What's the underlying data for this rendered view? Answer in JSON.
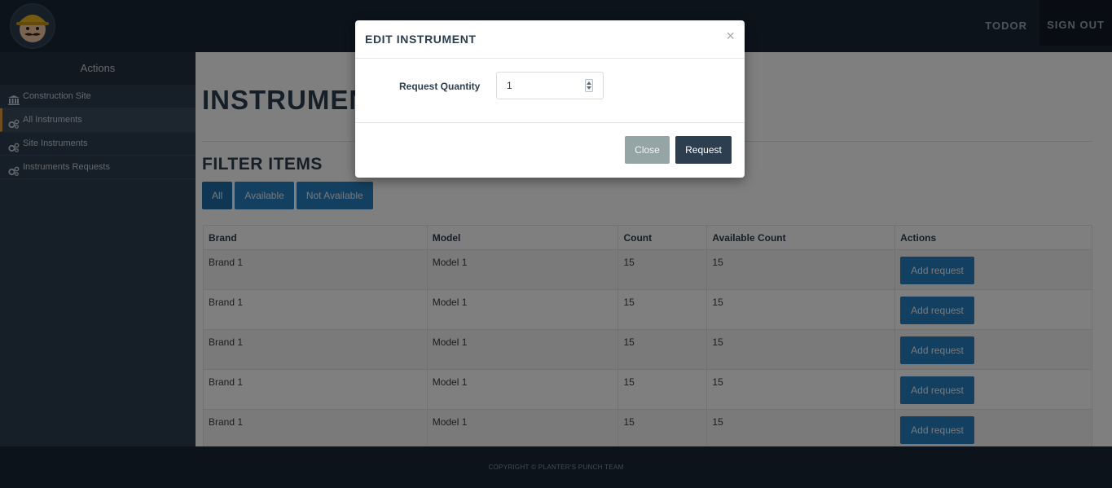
{
  "navbar": {
    "user_label": "TODOR",
    "signout_label": "SIGN OUT"
  },
  "sidebar": {
    "heading": "Actions",
    "items": [
      {
        "label": "Construction Site",
        "icon": "bank-icon"
      },
      {
        "label": "All Instruments",
        "icon": "gears-icon",
        "active": true
      },
      {
        "label": "Site Instruments",
        "icon": "gears-icon"
      },
      {
        "label": "Instruments Requests",
        "icon": "gears-icon"
      }
    ]
  },
  "main": {
    "title": "INSTRUMEN",
    "filter_title": "FILTER ITEMS",
    "filters": [
      "All",
      "Available",
      "Not Available"
    ],
    "table": {
      "headers": [
        "Brand",
        "Model",
        "Count",
        "Available Count",
        "Actions"
      ],
      "rows": [
        {
          "brand": "Brand 1",
          "model": "Model 1",
          "count": "15",
          "available": "15",
          "action": "Add request"
        },
        {
          "brand": "Brand 1",
          "model": "Model 1",
          "count": "15",
          "available": "15",
          "action": "Add request"
        },
        {
          "brand": "Brand 1",
          "model": "Model 1",
          "count": "15",
          "available": "15",
          "action": "Add request"
        },
        {
          "brand": "Brand 1",
          "model": "Model 1",
          "count": "15",
          "available": "15",
          "action": "Add request"
        },
        {
          "brand": "Brand 1",
          "model": "Model 1",
          "count": "15",
          "available": "15",
          "action": "Add request"
        }
      ]
    }
  },
  "footer": {
    "text": "COPYRIGHT © PLANTER'S PUNCH TEAM"
  },
  "modal": {
    "title": "EDIT INSTRUMENT",
    "close_symbol": "×",
    "field_label": "Request Quantity",
    "quantity_value": "1",
    "close_label": "Close",
    "request_label": "Request"
  },
  "colors": {
    "navbar": "#1a2636",
    "sidebar": "#2c3e50",
    "primary_button": "#2780c1",
    "active_accent": "#e79d3c",
    "close_button": "#95a5a6",
    "request_button": "#2c3e50"
  }
}
